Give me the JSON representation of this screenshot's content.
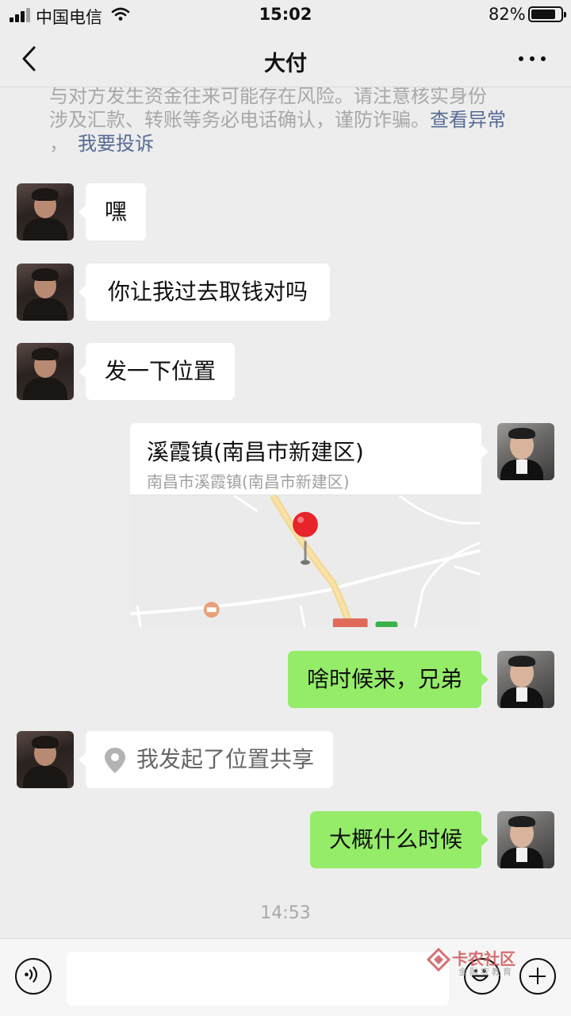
{
  "status_bar": {
    "carrier": "中国电信",
    "time": "15:02",
    "battery_percent": "82%",
    "battery_level": 0.82
  },
  "nav": {
    "title": "大付",
    "back_icon": "chevron-left-icon",
    "more_icon": "more-dots-icon"
  },
  "warning": {
    "line1": "与对方发生资金往来可能存在风险。请注意核实身份",
    "line2_text": "涉及汇款、转账等务必电话确认，谨防诈骗。",
    "link_view": "查看异常",
    "line3_prefix": "，",
    "link_report": "我要投诉"
  },
  "messages": [
    {
      "side": "in",
      "type": "text",
      "text": "嘿"
    },
    {
      "side": "in",
      "type": "text",
      "text": "你让我过去取钱对吗"
    },
    {
      "side": "in",
      "type": "text",
      "text": "发一下位置"
    },
    {
      "side": "out",
      "type": "location",
      "title": "溪霞镇(南昌市新建区)",
      "address": "南昌市溪霞镇(南昌市新建区)"
    },
    {
      "side": "out",
      "type": "text",
      "text": "啥时候来，兄弟"
    },
    {
      "side": "in",
      "type": "location_share",
      "text": "我发起了位置共享",
      "icon": "location-pin-icon"
    },
    {
      "side": "out",
      "type": "text",
      "text": "大概什么时候"
    }
  ],
  "timestamp": "14:53",
  "input_bar": {
    "voice_icon": "voice-icon",
    "emoji_icon": "emoji-icon",
    "plus_icon": "plus-icon",
    "input_value": ""
  },
  "watermark": {
    "title": "卡农社区",
    "subtitle": "金融农教育"
  },
  "colors": {
    "background": "#ededed",
    "incoming_bubble": "#ffffff",
    "outgoing_bubble": "#95ec69",
    "link": "#576b95",
    "map_pin": "#e8242b"
  }
}
